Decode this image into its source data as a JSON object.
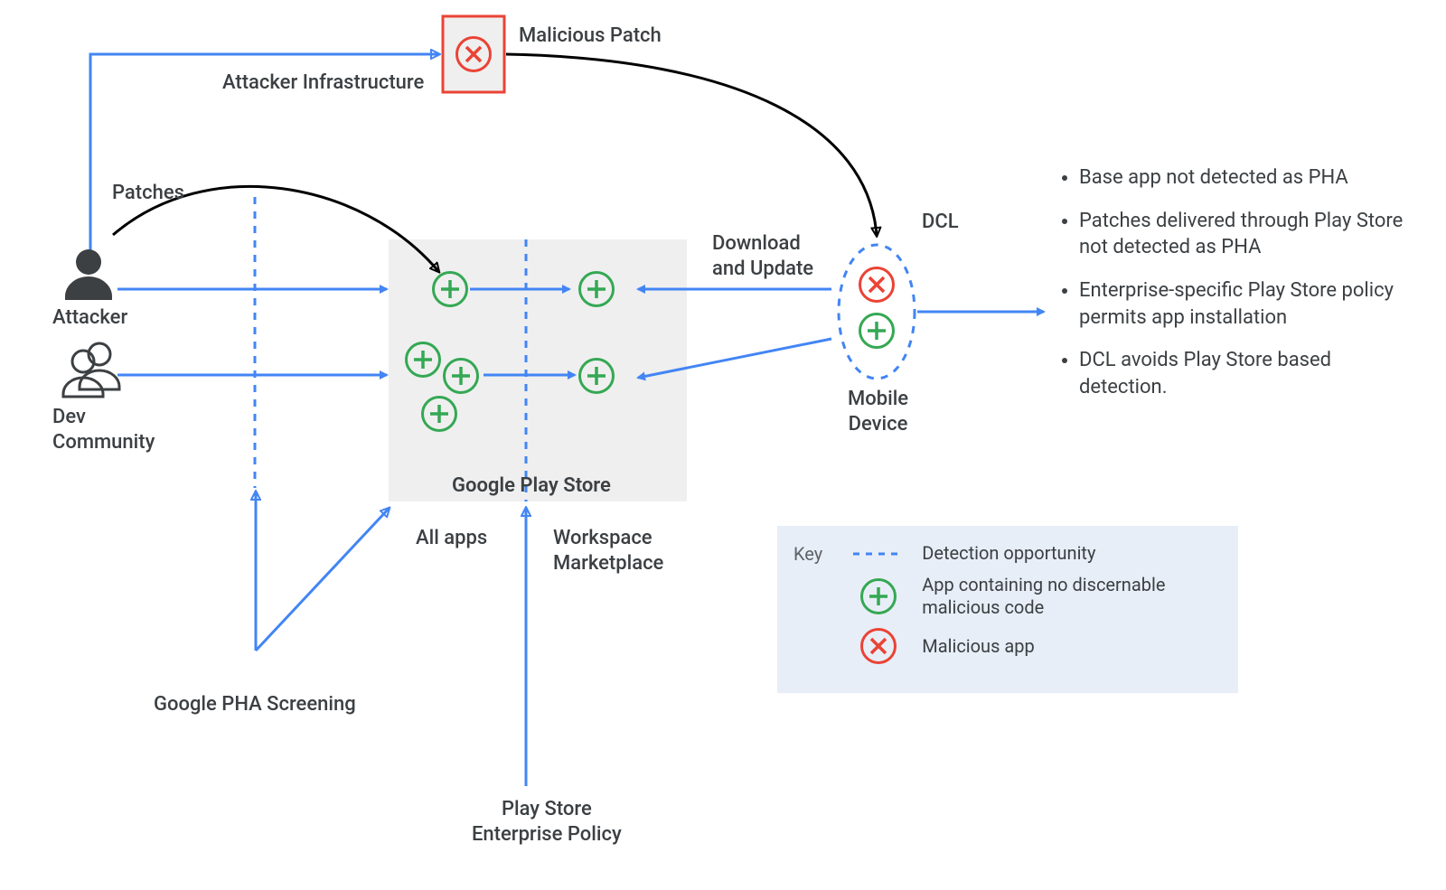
{
  "labels": {
    "attacker": "Attacker",
    "dev_community": "Dev\nCommunity",
    "patches": "Patches",
    "attacker_infra": "Attacker Infrastructure",
    "malicious_patch": "Malicious Patch",
    "download_update": "Download\nand Update",
    "dcl": "DCL",
    "mobile_device": "Mobile\nDevice",
    "google_play_store": "Google Play Store",
    "all_apps": "All apps",
    "workspace_marketplace": "Workspace\nMarketplace",
    "google_pha_screening": "Google PHA Screening",
    "play_store_enterprise_policy": "Play Store\nEnterprise Policy"
  },
  "bullets": [
    "Base app not detected as PHA",
    "Patches delivered through Play Store not detected as PHA",
    "Enterprise-specific Play Store policy permits app installation",
    "DCL avoids Play Store based detection."
  ],
  "key": {
    "title": "Key",
    "detection": "Detection opportunity",
    "good": "App containing no discernable malicious code",
    "bad": "Malicious app"
  },
  "colors": {
    "blue": "#4285F4",
    "green": "#34A853",
    "red": "#EA4335",
    "panel": "#EFEFEF",
    "keybg": "#E8EEF7",
    "text": "#3c4043"
  }
}
